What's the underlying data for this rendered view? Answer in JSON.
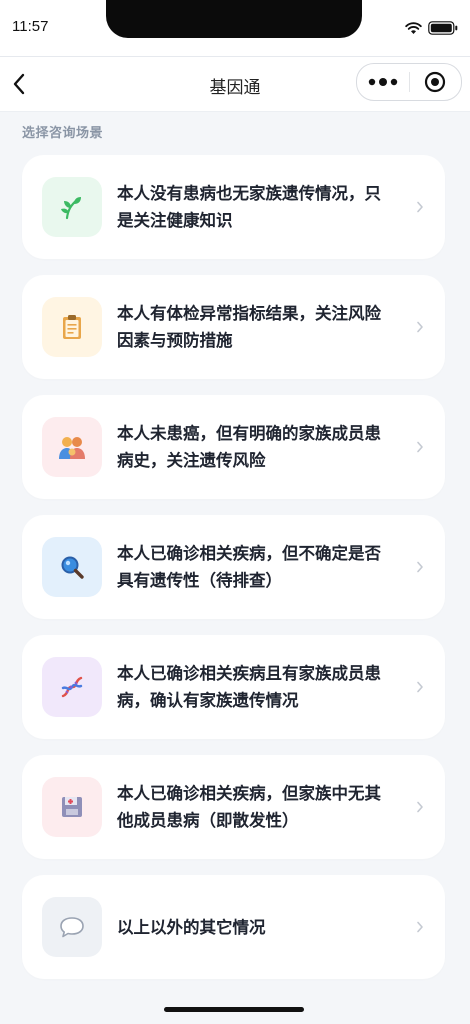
{
  "status_bar": {
    "time": "11:57"
  },
  "nav": {
    "title": "基因通"
  },
  "section_label": "选择咨询场景",
  "scenarios": [
    {
      "text": "本人没有患病也无家族遗传情况，只是关注健康知识",
      "icon": "sprout-icon",
      "bg": "#e9f8ee",
      "color": "#3cba63"
    },
    {
      "text": "本人有体检异常指标结果，关注风险因素与预防措施",
      "icon": "clipboard-icon",
      "bg": "#fff5e3",
      "color": "#e8a64a"
    },
    {
      "text": "本人未患癌，但有明确的家族成员患病史，关注遗传风险",
      "icon": "family-icon",
      "bg": "#fdecee",
      "color": "#e47b6a"
    },
    {
      "text": "本人已确诊相关疾病，但不确定是否具有遗传性（待排查）",
      "icon": "magnifier-icon",
      "bg": "#e3f0fc",
      "color": "#3a8de0"
    },
    {
      "text": "本人已确诊相关疾病且有家族成员患病，确认有家族遗传情况",
      "icon": "dna-icon",
      "bg": "#f1e8fb",
      "color": "#8a5cd6"
    },
    {
      "text": "本人已确诊相关疾病，但家族中无其他成员患病（即散发性）",
      "icon": "medical-floppy-icon",
      "bg": "#fdecee",
      "color": "#8f8fb8"
    },
    {
      "text": "以上以外的其它情况",
      "icon": "speech-bubble-icon",
      "bg": "#eef1f5",
      "color": "#9aa3b2"
    }
  ]
}
